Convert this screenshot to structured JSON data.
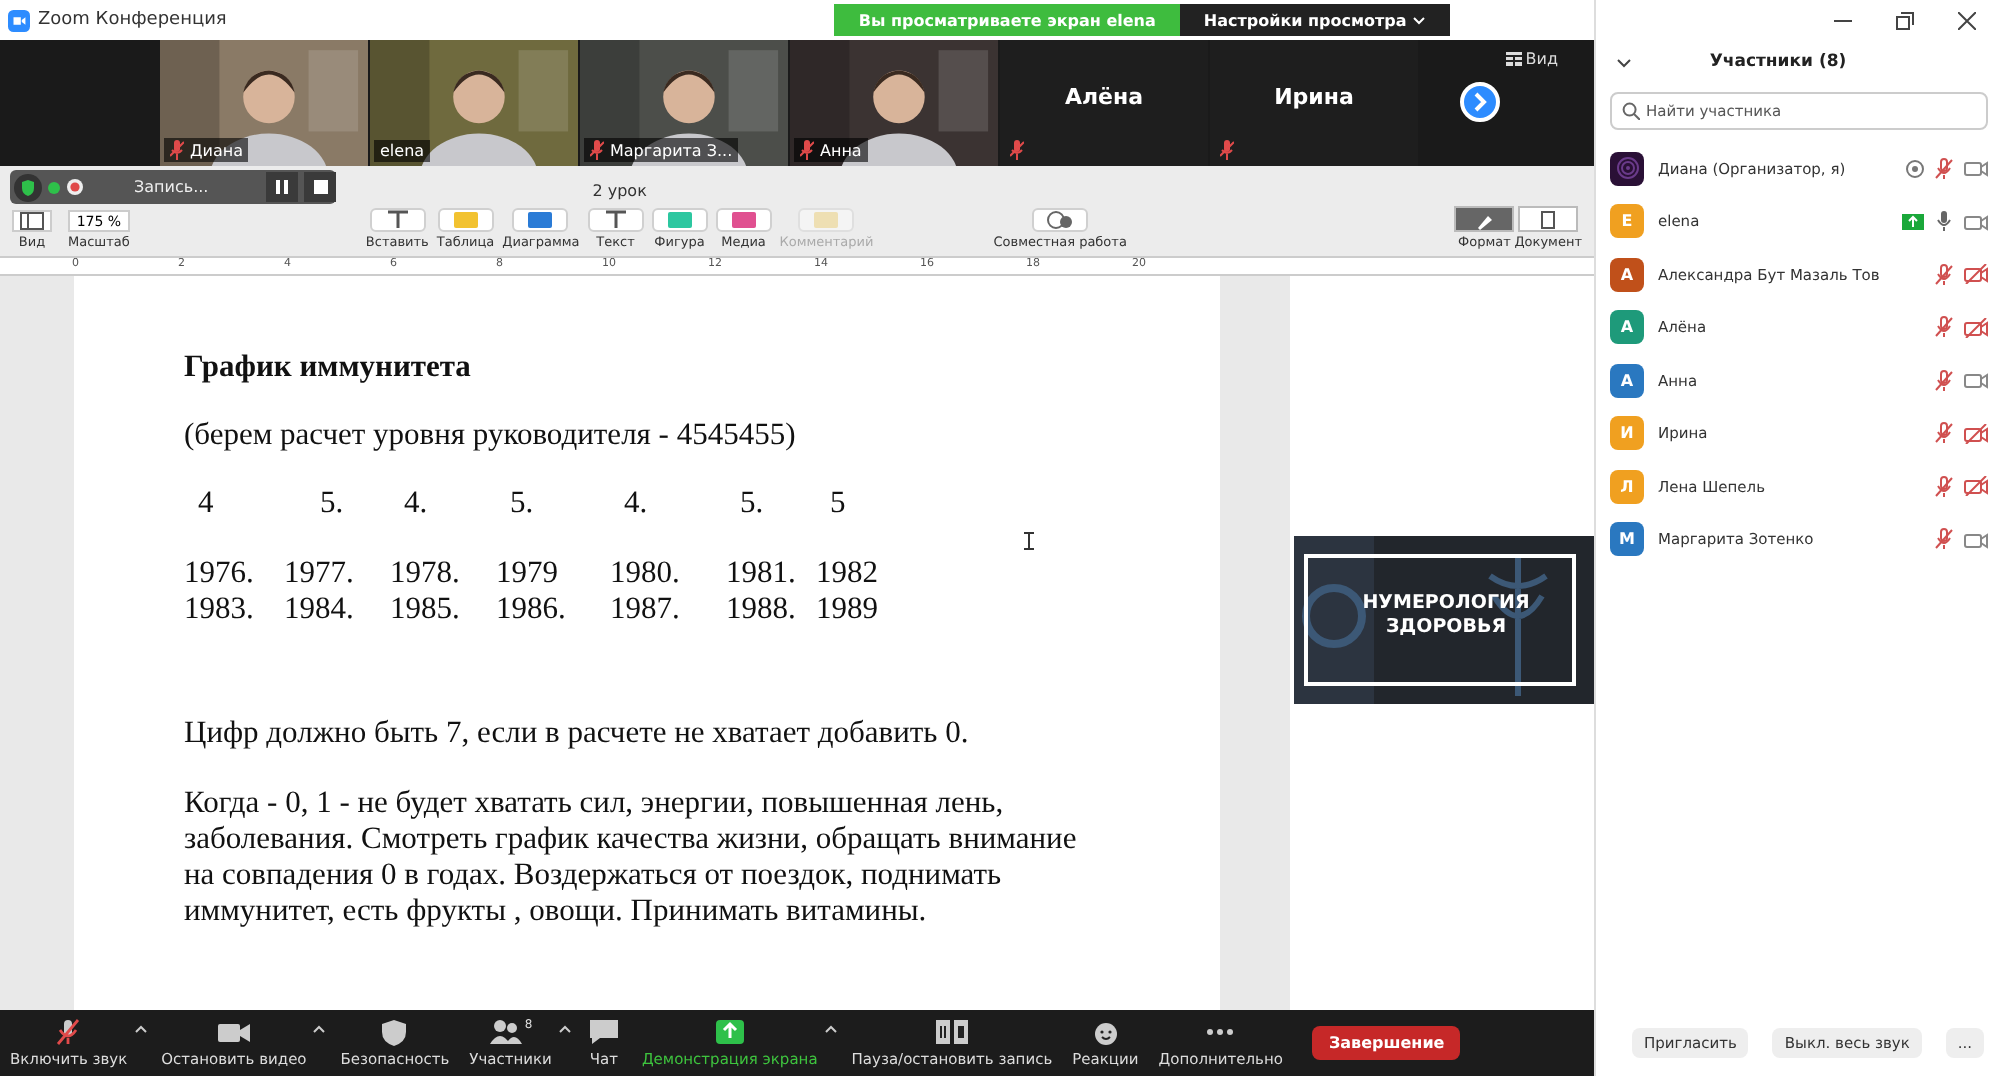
{
  "window": {
    "title": "Zoom Конференция"
  },
  "share_banner": {
    "text": "Вы просматриваете экран elena",
    "settings": "Настройки просмотра"
  },
  "video_tiles": [
    {
      "name": "Диана",
      "kind": "video",
      "muted": true
    },
    {
      "name": "elena",
      "kind": "video",
      "muted": false
    },
    {
      "name": "Маргарита З...",
      "kind": "video",
      "muted": true
    },
    {
      "name": "Анна",
      "kind": "video",
      "muted": true
    },
    {
      "name": "Алёна",
      "kind": "name",
      "muted": true
    },
    {
      "name": "Ирина",
      "kind": "name",
      "muted": true
    }
  ],
  "view_button": "Вид",
  "recording": {
    "label": "Запись..."
  },
  "doc_toolbar": {
    "doc_title": "2 урок",
    "view": "Вид",
    "zoom_value": "175 %",
    "zoom_label": "Масштаб",
    "tools": [
      {
        "label": "Вставить",
        "kind": "paragraph",
        "disabled": false
      },
      {
        "label": "Таблица",
        "kind": "table",
        "disabled": false
      },
      {
        "label": "Диаграмма",
        "kind": "chart",
        "disabled": false
      },
      {
        "label": "Текст",
        "kind": "text",
        "disabled": false
      },
      {
        "label": "Фигура",
        "kind": "shape",
        "disabled": false
      },
      {
        "label": "Медиа",
        "kind": "media",
        "disabled": false
      },
      {
        "label": "Комментарий",
        "kind": "comment",
        "disabled": true
      }
    ],
    "collab": "Совместная работа",
    "panels": [
      {
        "label": "Формат",
        "kind": "format",
        "selected": true
      },
      {
        "label": "Документ",
        "kind": "document",
        "selected": false
      }
    ]
  },
  "ruler": [
    "0",
    "2",
    "4",
    "6",
    "8",
    "10",
    "12",
    "14",
    "16",
    "18",
    "20"
  ],
  "document": {
    "title": "График иммунитета",
    "subtitle": "(берем расчет уровня руководителя - 4545455)",
    "digits": [
      "4",
      "5.",
      "4.",
      "5.",
      "4.",
      "5.",
      "5"
    ],
    "years": [
      [
        "1976.",
        "1977.",
        "1978.",
        "1979",
        "1980.",
        "1981.",
        "1982"
      ],
      [
        "1983.",
        "1984.",
        "1985.",
        "1986.",
        "1987.",
        "1988.",
        "1989"
      ]
    ],
    "paragraphs": [
      "Цифр должно быть 7, если в расчете не хватает добавить 0.",
      " Когда - 0, 1 - не будет хватать сил, энергии, повышенная лень, заболевания. Смотреть график качества жизни, обращать внимание на совпадения 0 в годах. Воздержаться от поездок, поднимать иммунитет, есть фрукты , овощи. Принимать витамины."
    ]
  },
  "banner_image": {
    "kind": "picture",
    "title": "НУМЕРОЛОГИЯ ЗДОРОВЬЯ"
  },
  "meeting_controls": [
    {
      "label": "Включить звук",
      "kind": "mic",
      "caret": true
    },
    {
      "label": "Остановить видео",
      "kind": "video",
      "caret": true
    },
    {
      "label": "Безопасность",
      "kind": "security",
      "caret": false
    },
    {
      "label": "Участники",
      "kind": "participants",
      "caret": true,
      "count": "8"
    },
    {
      "label": "Чат",
      "kind": "chat",
      "caret": false
    },
    {
      "label": "Демонстрация экрана",
      "kind": "share",
      "caret": true
    },
    {
      "label": "Пауза/остановить запись",
      "kind": "record",
      "caret": false
    },
    {
      "label": "Реакции",
      "kind": "reactions",
      "caret": false
    },
    {
      "label": "Дополнительно",
      "kind": "more",
      "caret": false
    }
  ],
  "end_button": "Завершение",
  "participants_panel": {
    "title": "Участники (8)",
    "search_placeholder": "Найти участника",
    "participants": [
      {
        "name": "Диана (Организатор, я)",
        "color": "#2a1036",
        "recording": true,
        "sharing": false,
        "mic_muted": true,
        "video_off": false
      },
      {
        "name": "elena",
        "kind": "letter",
        "avatar": "E",
        "color": "#f0a020",
        "recording": false,
        "sharing": true,
        "mic_muted": false,
        "video_off": false
      },
      {
        "name": "Александра Бут Мазаль Тов",
        "kind": "letter",
        "avatar": "А",
        "color": "#c0501a",
        "recording": false,
        "sharing": false,
        "mic_muted": true,
        "video_off": true
      },
      {
        "name": "Алёна",
        "kind": "letter",
        "avatar": "А",
        "color": "#1e9a7a",
        "recording": false,
        "sharing": false,
        "mic_muted": true,
        "video_off": true
      },
      {
        "name": "Анна",
        "kind": "letter",
        "avatar": "А",
        "color": "#2a78c0",
        "recording": false,
        "sharing": false,
        "mic_muted": true,
        "video_off": false
      },
      {
        "name": "Ирина",
        "kind": "letter",
        "avatar": "И",
        "color": "#f0a020",
        "recording": false,
        "sharing": false,
        "mic_muted": true,
        "video_off": true
      },
      {
        "name": "Лена Шепель",
        "kind": "letter",
        "avatar": "Л",
        "color": "#f0a020",
        "recording": false,
        "sharing": false,
        "mic_muted": true,
        "video_off": true
      },
      {
        "name": "Маргарита Зотенко",
        "kind": "letter",
        "avatar": "М",
        "color": "#2a78c0",
        "recording": false,
        "sharing": false,
        "mic_muted": true,
        "video_off": false
      }
    ],
    "buttons": [
      "Пригласить",
      "Выкл. весь звук",
      "..."
    ]
  }
}
